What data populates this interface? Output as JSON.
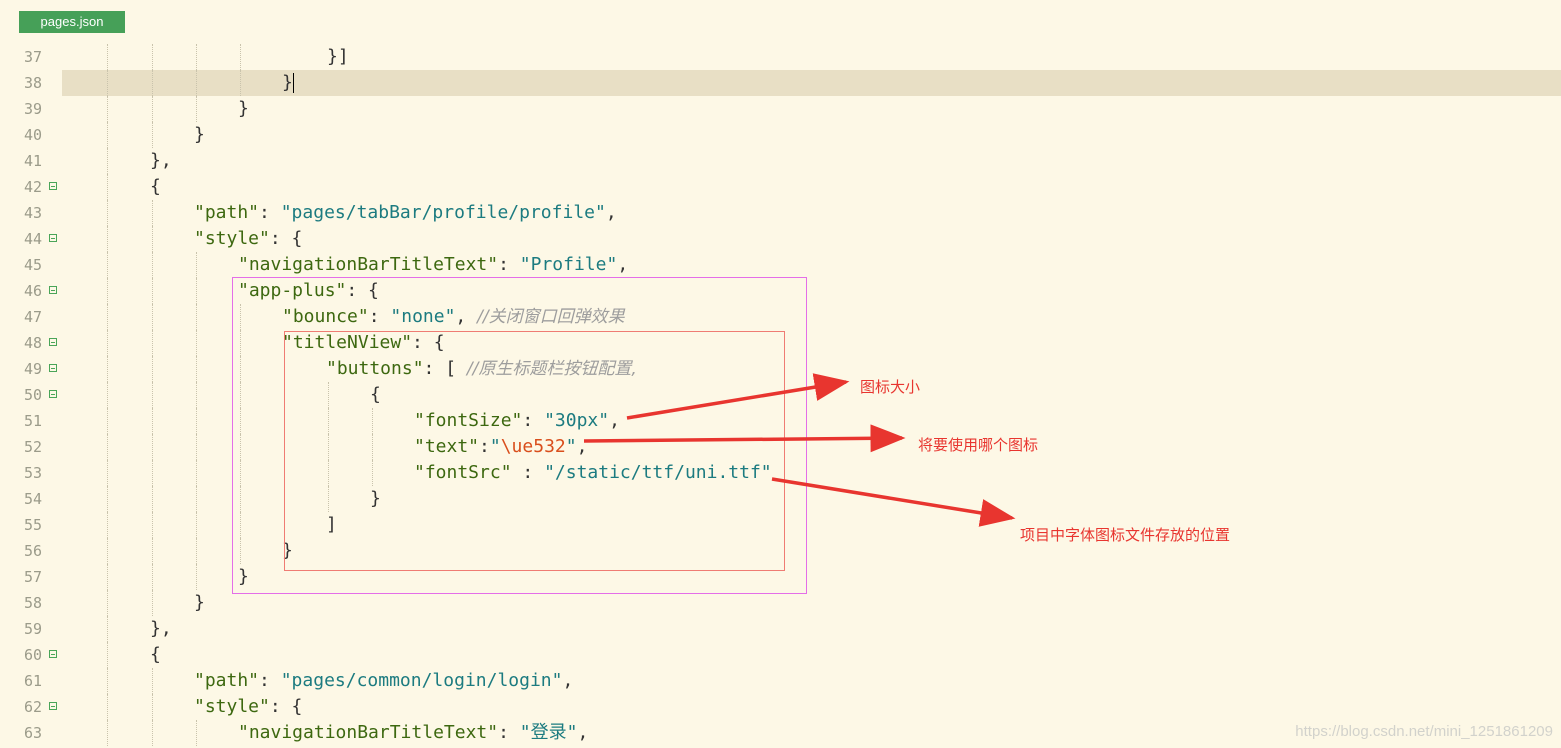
{
  "tab": {
    "label": "pages.json"
  },
  "gutter": [
    {
      "n": "37",
      "fold": false
    },
    {
      "n": "38",
      "fold": false
    },
    {
      "n": "39",
      "fold": false
    },
    {
      "n": "40",
      "fold": false
    },
    {
      "n": "41",
      "fold": false
    },
    {
      "n": "42",
      "fold": true
    },
    {
      "n": "43",
      "fold": false
    },
    {
      "n": "44",
      "fold": true
    },
    {
      "n": "45",
      "fold": false
    },
    {
      "n": "46",
      "fold": true
    },
    {
      "n": "47",
      "fold": false
    },
    {
      "n": "48",
      "fold": true
    },
    {
      "n": "49",
      "fold": true
    },
    {
      "n": "50",
      "fold": true
    },
    {
      "n": "51",
      "fold": false
    },
    {
      "n": "52",
      "fold": false
    },
    {
      "n": "53",
      "fold": false
    },
    {
      "n": "54",
      "fold": false
    },
    {
      "n": "55",
      "fold": false
    },
    {
      "n": "56",
      "fold": false
    },
    {
      "n": "57",
      "fold": false
    },
    {
      "n": "58",
      "fold": false
    },
    {
      "n": "59",
      "fold": false
    },
    {
      "n": "60",
      "fold": true
    },
    {
      "n": "61",
      "fold": false
    },
    {
      "n": "62",
      "fold": true
    },
    {
      "n": "63",
      "fold": false
    }
  ],
  "code": {
    "l37": {
      "close": "}]"
    },
    "l38": {
      "close": "}"
    },
    "l39": {
      "close": "}"
    },
    "l40": {
      "close": "}"
    },
    "l41": {
      "close": "},"
    },
    "l42": {
      "open": "{"
    },
    "l43": {
      "key": "\"path\"",
      "sep": ": ",
      "val": "\"pages/tabBar/profile/profile\"",
      "end": ","
    },
    "l44": {
      "key": "\"style\"",
      "sep": ": {"
    },
    "l45": {
      "key": "\"navigationBarTitleText\"",
      "sep": ": ",
      "val": "\"Profile\"",
      "end": ","
    },
    "l46": {
      "key": "\"app-plus\"",
      "sep": ": {"
    },
    "l47": {
      "key": "\"bounce\"",
      "sep": ": ",
      "val": "\"none\"",
      "end": ", ",
      "comment": "//关闭窗口回弹效果"
    },
    "l48": {
      "key": "\"titleNView\"",
      "sep": ": {"
    },
    "l49": {
      "key": "\"buttons\"",
      "sep": ": [ ",
      "comment": "//原生标题栏按钮配置,"
    },
    "l50": {
      "open": "{"
    },
    "l51": {
      "key": "\"fontSize\"",
      "sep": ": ",
      "val": "\"30px\"",
      "end": ","
    },
    "l52": {
      "key": "\"text\"",
      "sep": ":",
      "q1": "\"",
      "esc": "\\ue532",
      "q2": "\"",
      "end": ","
    },
    "l53": {
      "key": "\"fontSrc\"",
      "sep": " : ",
      "val": "\"/static/ttf/uni.ttf\""
    },
    "l54": {
      "close": "}"
    },
    "l55": {
      "close": "]"
    },
    "l56": {
      "close": "}"
    },
    "l57": {
      "close": "}"
    },
    "l58": {
      "close": "}"
    },
    "l59": {
      "close": "},"
    },
    "l60": {
      "open": "{"
    },
    "l61": {
      "key": "\"path\"",
      "sep": ": ",
      "val": "\"pages/common/login/login\"",
      "end": ","
    },
    "l62": {
      "key": "\"style\"",
      "sep": ": {"
    },
    "l63": {
      "key": "\"navigationBarTitleText\"",
      "sep": ": ",
      "val": "\"登录\"",
      "end": ","
    }
  },
  "annotations": {
    "icon_size": "图标大小",
    "which_icon": "将要使用哪个图标",
    "font_location": "项目中字体图标文件存放的位置"
  },
  "watermark": "https://blog.csdn.net/mini_1251861209",
  "colors": {
    "background": "#fdf8e6",
    "current_line": "#e8dfc5",
    "tab": "#46a058",
    "key": "#3d6810",
    "string": "#1c7b80",
    "escape": "#d94e1c",
    "comment": "#9d9d9d",
    "annotation": "#e8352f",
    "outer_box": "#e46ee8",
    "inner_box": "#ef7c73"
  }
}
